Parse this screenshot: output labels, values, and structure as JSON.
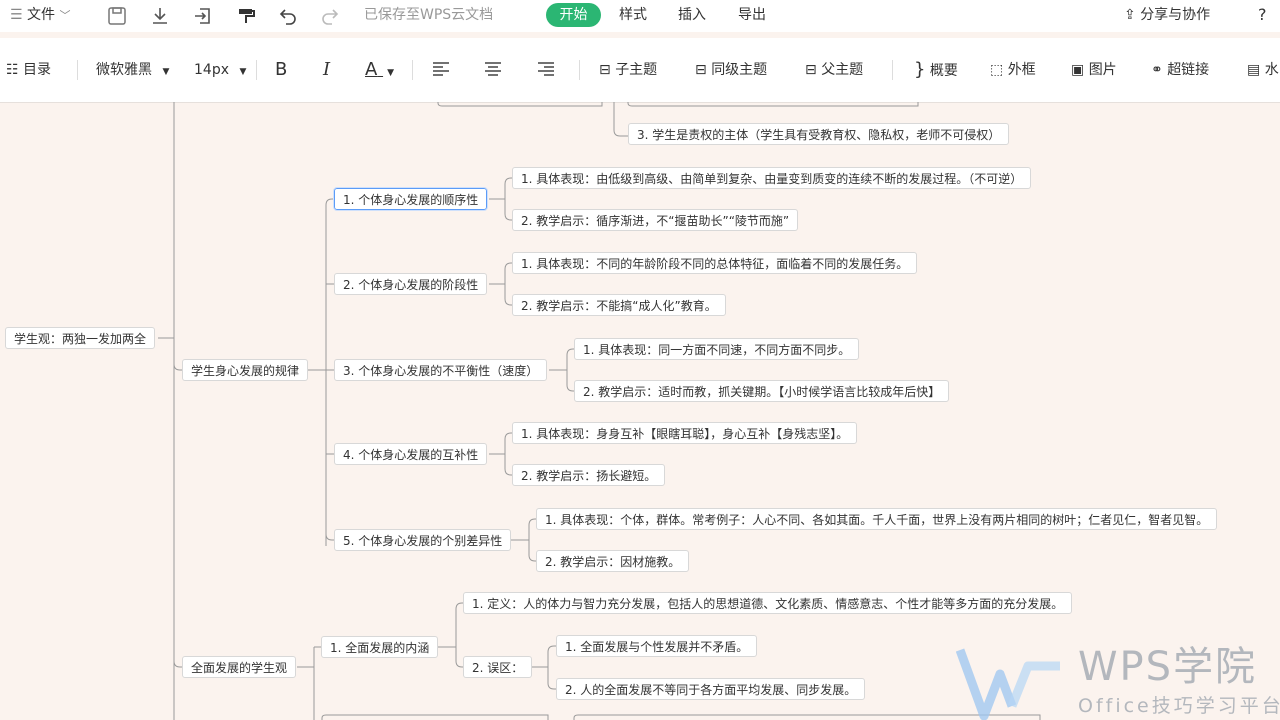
{
  "menu": {
    "file": "文件",
    "saved": "已保存至WPS云文档",
    "tab_start": "开始",
    "tab_style": "样式",
    "tab_insert": "插入",
    "tab_export": "导出",
    "share": "分享与协作",
    "help": "?"
  },
  "toolbar": {
    "toc": "目录",
    "font": "微软雅黑",
    "size": "14px",
    "bold": "B",
    "italic": "I",
    "fontcolor": "A",
    "subtopic": "子主题",
    "sibling": "同级主题",
    "parent": "父主题",
    "summary": "概要",
    "frame": "外框",
    "image": "图片",
    "link": "超链接",
    "more": "水"
  },
  "mindmap": {
    "root": "学生观：两独一发加两全",
    "partial_top": "3. 学生是责权的主体（学生具有受教育权、隐私权，老师不可侵权）",
    "law": {
      "label": "学生身心发展的规律",
      "items": [
        {
          "label": "1. 个体身心发展的顺序性",
          "c1": "1. 具体表现：由低级到高级、由简单到复杂、由量变到质变的连续不断的发展过程。（不可逆）",
          "c2": "2. 教学启示：循序渐进，不“揠苗助长”“陵节而施”"
        },
        {
          "label": "2. 个体身心发展的阶段性",
          "c1": "1. 具体表现：不同的年龄阶段不同的总体特征，面临着不同的发展任务。",
          "c2": "2. 教学启示：不能搞“成人化”教育。"
        },
        {
          "label": "3. 个体身心发展的不平衡性（速度）",
          "c1": "1. 具体表现：同一方面不同速，不同方面不同步。",
          "c2": "2. 教学启示：适时而教，抓关键期。【小时候学语言比较成年后快】"
        },
        {
          "label": "4. 个体身心发展的互补性",
          "c1": "1. 具体表现：身身互补【眼瞎耳聪】，身心互补【身残志坚】。",
          "c2": "2. 教学启示：扬长避短。"
        },
        {
          "label": "5. 个体身心发展的个别差异性",
          "c1": "1. 具体表现：个体，群体。常考例子：人心不同、各如其面。千人千面，世界上没有两片相同的树叶；仁者见仁，智者见智。",
          "c2": "2. 教学启示：因材施教。"
        }
      ]
    },
    "full": {
      "label": "全面发展的学生观",
      "connotation": "1. 全面发展的内涵",
      "definition": "1. 定义：人的体力与智力充分发展，包括人的思想道德、文化素质、情感意志、个性才能等多方面的充分发展。",
      "misconception": "2. 误区：",
      "mis1": "1. 全面发展与个性发展并不矛盾。",
      "mis2": "2. 人的全面发展不等同于各方面平均发展、同步发展。"
    }
  },
  "watermark": {
    "brand": "WPS学院",
    "sub": "Office技巧学习平台"
  },
  "colors": {
    "accent": "#2bb673",
    "canvas": "#fbf3ee",
    "line": "#9a9a9a",
    "select": "#5b9bf7"
  }
}
